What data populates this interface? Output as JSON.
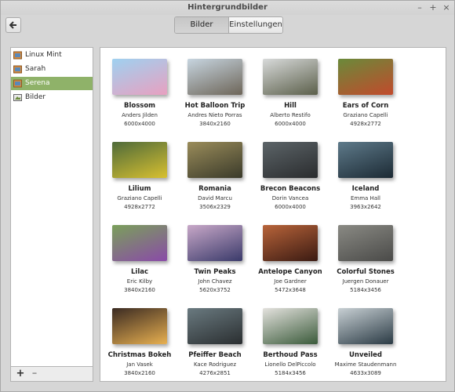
{
  "window": {
    "title": "Hintergrundbilder",
    "controls": [
      "–",
      "+",
      "×"
    ]
  },
  "toolbar": {
    "tabs": [
      {
        "label": "Bilder",
        "active": true
      },
      {
        "label": "Einstellungen",
        "active": false
      }
    ]
  },
  "sidebar": {
    "items": [
      {
        "label": "Linux Mint",
        "icon": "folder-icon"
      },
      {
        "label": "Sarah",
        "icon": "folder-icon"
      },
      {
        "label": "Serena",
        "icon": "folder-icon",
        "selected": true
      },
      {
        "label": "Bilder",
        "icon": "image-folder-icon"
      }
    ],
    "add_label": "+",
    "remove_label": "–"
  },
  "gallery": {
    "items": [
      {
        "name": "Blossom",
        "author": "Anders Jilden",
        "size": "6000x4000",
        "colors": [
          "#9fd1f0",
          "#e8a0c0"
        ]
      },
      {
        "name": "Hot Balloon Trip",
        "author": "Andres Nieto Porras",
        "size": "3840x2160",
        "colors": [
          "#c7d5e0",
          "#6d6558"
        ]
      },
      {
        "name": "Hill",
        "author": "Alberto Restifo",
        "size": "6000x4000",
        "colors": [
          "#d8dada",
          "#5b5f4a"
        ]
      },
      {
        "name": "Ears of Corn",
        "author": "Graziano Capelli",
        "size": "4928x2772",
        "colors": [
          "#6a8a3a",
          "#c24a2c"
        ]
      },
      {
        "name": "Lilium",
        "author": "Graziano Capelli",
        "size": "4928x2772",
        "colors": [
          "#4e6a3a",
          "#d8c030"
        ]
      },
      {
        "name": "Romania",
        "author": "David Marcu",
        "size": "3506x2329",
        "colors": [
          "#9a8c5a",
          "#3a3a2a"
        ]
      },
      {
        "name": "Brecon Beacons",
        "author": "Dorin Vancea",
        "size": "6000x4000",
        "colors": [
          "#5c6468",
          "#2a2c2e"
        ]
      },
      {
        "name": "Iceland",
        "author": "Emma Hall",
        "size": "3963x2642",
        "colors": [
          "#5e7a8a",
          "#1c2a34"
        ]
      },
      {
        "name": "Lilac",
        "author": "Eric Kilby",
        "size": "3840x2160",
        "colors": [
          "#7aa05a",
          "#8a4aa8"
        ]
      },
      {
        "name": "Twin Peaks",
        "author": "John Chavez",
        "size": "5620x3752",
        "colors": [
          "#c8a8c8",
          "#3a3a6a"
        ]
      },
      {
        "name": "Antelope Canyon",
        "author": "Joe Gardner",
        "size": "5472x3648",
        "colors": [
          "#b8643a",
          "#3a1a12"
        ]
      },
      {
        "name": "Colorful Stones",
        "author": "Juergen Donauer",
        "size": "5184x3456",
        "colors": [
          "#8a8a84",
          "#4a4a48"
        ]
      },
      {
        "name": "Christmas Bokeh",
        "author": "Jan Vasek",
        "size": "3840x2160",
        "colors": [
          "#3a2a22",
          "#e8b050"
        ]
      },
      {
        "name": "Pfeiffer Beach",
        "author": "Kace Rodriguez",
        "size": "4276x2851",
        "colors": [
          "#6a7a80",
          "#2a2e30"
        ]
      },
      {
        "name": "Berthoud Pass",
        "author": "Lionello DelPiccolo",
        "size": "5184x3456",
        "colors": [
          "#e4e2de",
          "#3a5a3a"
        ]
      },
      {
        "name": "Unveiled",
        "author": "Maxime Staudenmann",
        "size": "4633x3089",
        "colors": [
          "#c8d0d4",
          "#2a3a44"
        ]
      }
    ]
  },
  "colors": {
    "selection": "#8fb269"
  }
}
